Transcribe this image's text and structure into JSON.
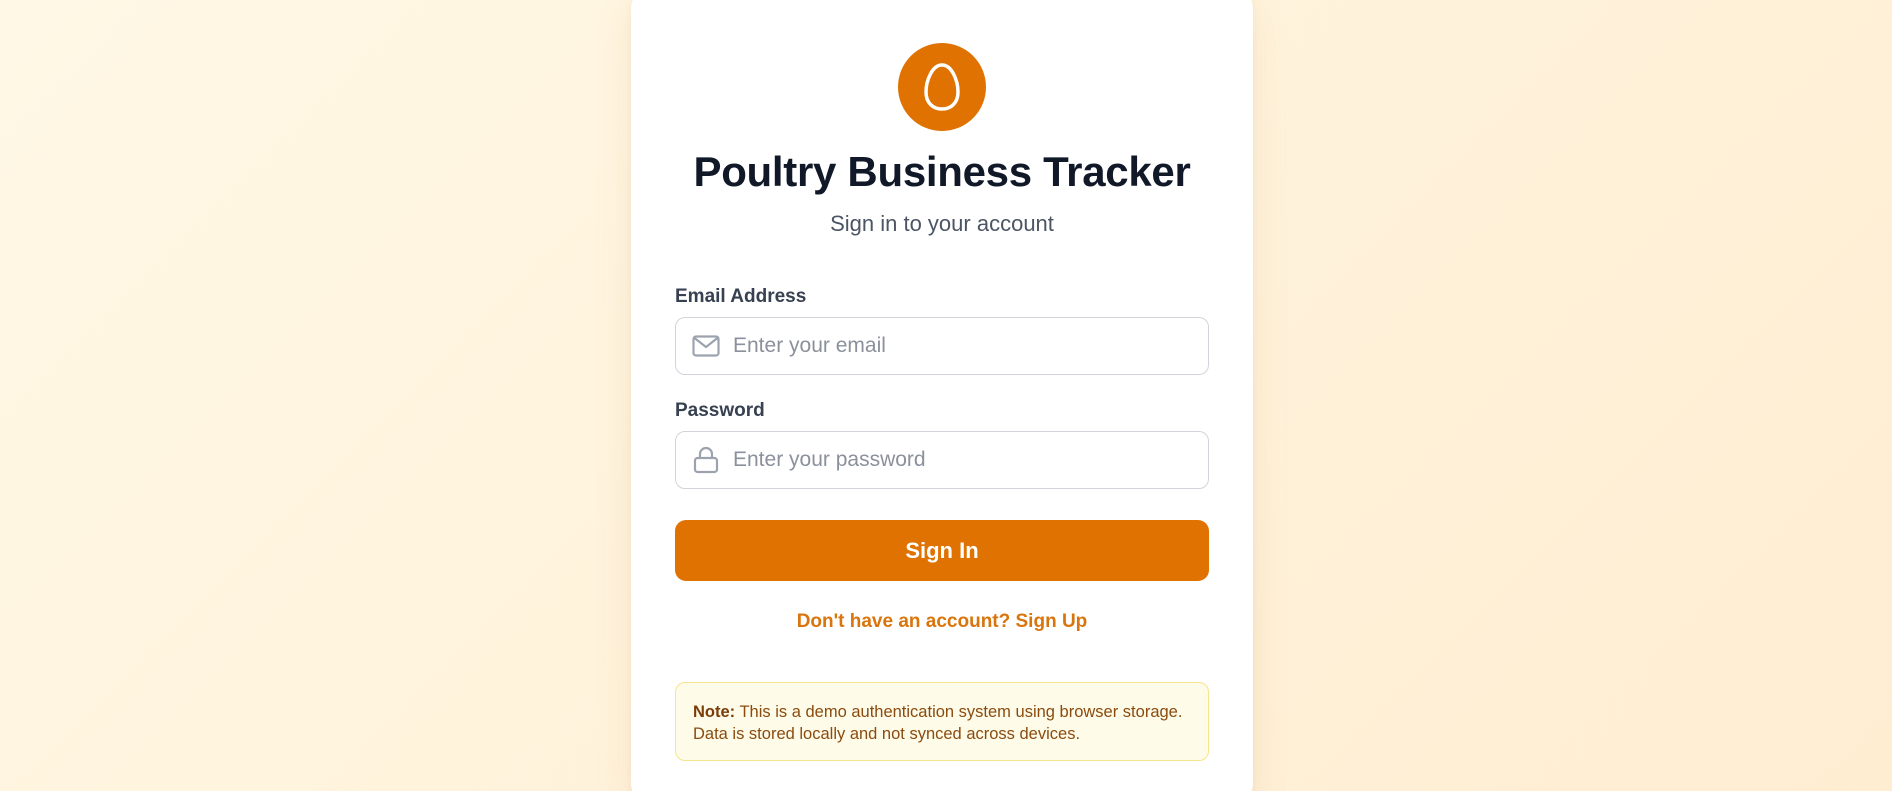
{
  "app": {
    "title": "Poultry Business Tracker",
    "subtitle": "Sign in to your account",
    "logo_icon": "egg-icon"
  },
  "form": {
    "email": {
      "label": "Email Address",
      "placeholder": "Enter your email",
      "value": "",
      "icon": "mail-icon"
    },
    "password": {
      "label": "Password",
      "placeholder": "Enter your password",
      "value": "",
      "icon": "lock-icon"
    },
    "submit_label": "Sign In"
  },
  "signup_link": "Don't have an account? Sign Up",
  "note": {
    "prefix": "Note:",
    "text": "This is a demo authentication system using browser storage. Data is stored locally and not synced across devices."
  },
  "colors": {
    "accent": "#e07202",
    "link": "#d9750d",
    "note_bg": "#fefbe8",
    "note_border": "#f6e58a"
  }
}
